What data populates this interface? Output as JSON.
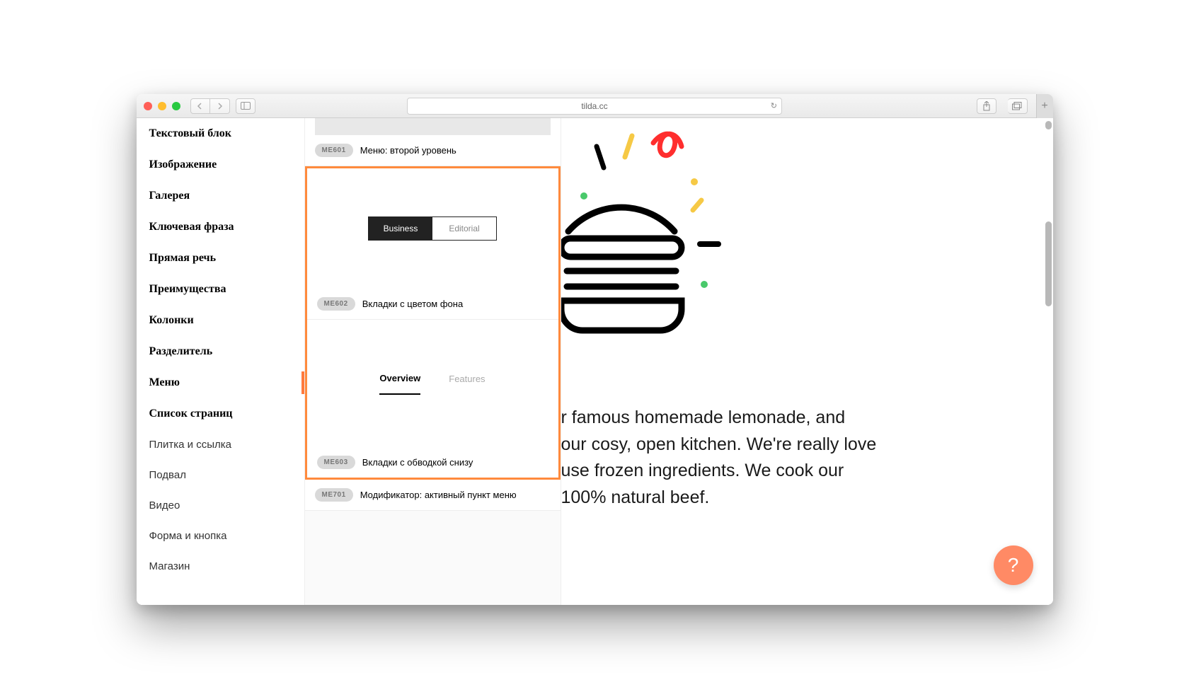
{
  "browser": {
    "url": "tilda.cc"
  },
  "sidebar": {
    "items": [
      {
        "label": "Текстовый блок",
        "strong": true
      },
      {
        "label": "Изображение",
        "strong": true
      },
      {
        "label": "Галерея",
        "strong": true
      },
      {
        "label": "Ключевая фраза",
        "strong": true
      },
      {
        "label": "Прямая речь",
        "strong": true
      },
      {
        "label": "Преимущества",
        "strong": true
      },
      {
        "label": "Колонки",
        "strong": true
      },
      {
        "label": "Разделитель",
        "strong": true
      },
      {
        "label": "Меню",
        "strong": true,
        "active": true
      },
      {
        "label": "Список страниц",
        "strong": true
      },
      {
        "label": "Плитка и ссылка",
        "strong": false
      },
      {
        "label": "Подвал",
        "strong": false
      },
      {
        "label": "Видео",
        "strong": false
      },
      {
        "label": "Форма и кнопка",
        "strong": false
      },
      {
        "label": "Магазин",
        "strong": false
      }
    ]
  },
  "blocks": {
    "me601": {
      "code": "ME601",
      "title": "Меню: второй уровень"
    },
    "me602": {
      "code": "ME602",
      "title": "Вкладки с цветом фона",
      "tabs": [
        "Business",
        "Editorial"
      ]
    },
    "me603": {
      "code": "ME603",
      "title": "Вкладки с обводкой снизу",
      "tabs": [
        "Overview",
        "Features"
      ]
    },
    "me701": {
      "code": "ME701",
      "title": "Модификатор: активный пункт меню"
    }
  },
  "preview_text": {
    "l1": "r famous homemade lemonade, and",
    "l2": "our cosy, open kitchen. We're really love",
    "l3": "use frozen ingredients. We cook our",
    "l4": "100% natural beef."
  },
  "help": "?"
}
